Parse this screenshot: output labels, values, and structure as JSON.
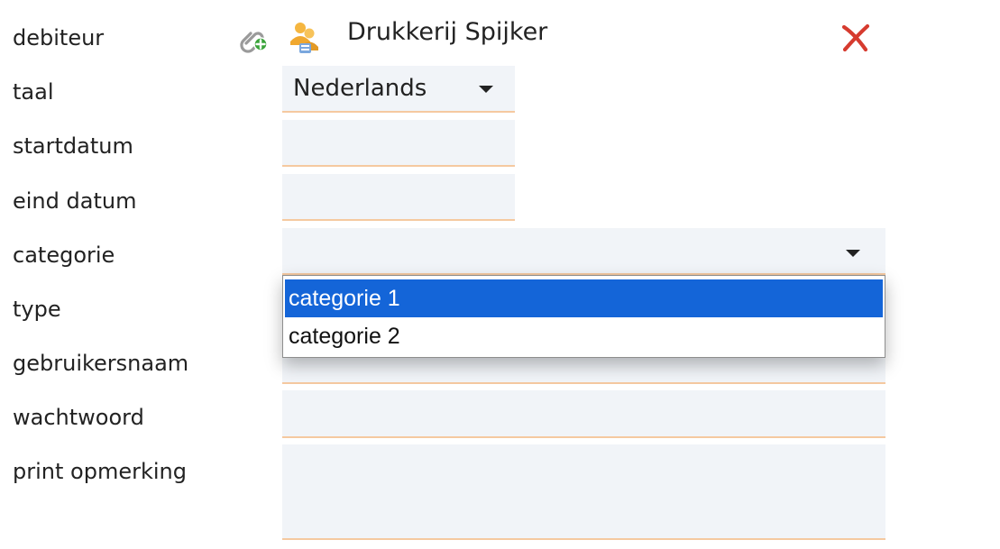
{
  "fields": [
    {
      "label": "debiteur"
    },
    {
      "label": "taal"
    },
    {
      "label": "startdatum"
    },
    {
      "label": "eind datum"
    },
    {
      "label": "categorie"
    },
    {
      "label": "type"
    },
    {
      "label": "gebruikersnaam"
    },
    {
      "label": "wachtwoord"
    },
    {
      "label": "print opmerking"
    }
  ],
  "debiteur": {
    "name": "Drukkerij Spijker",
    "link_icon": "link-add-icon",
    "customer_icon": "customer-group-icon",
    "remove_icon": "remove-x-icon",
    "remove_color": "#d63b2f"
  },
  "taal": {
    "value": "Nederlands"
  },
  "categorie": {
    "value": "",
    "options": [
      "categorie 1",
      "categorie 2"
    ],
    "selected_option": "categorie 1"
  },
  "colors": {
    "field_bg": "#f1f4f8",
    "field_border": "#f5c9a0",
    "selection_bg": "#1465d8"
  }
}
